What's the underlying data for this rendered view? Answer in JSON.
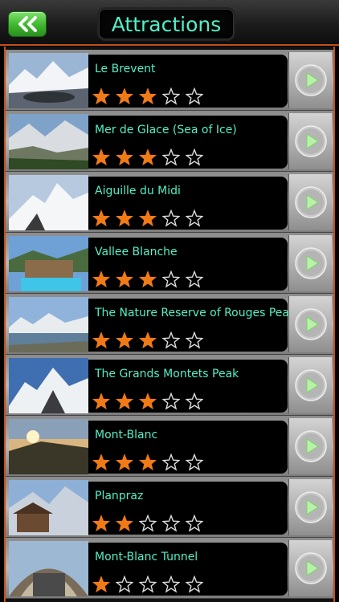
{
  "header": {
    "back_icon": "double-chevron-left-icon",
    "title": "Attractions"
  },
  "colors": {
    "accent_text": "#52f0c8",
    "star_filled": "#f07a16",
    "border": "#c0501c",
    "back_button": "#4ec23c"
  },
  "items": [
    {
      "name": "Le Brevent",
      "rating": 3,
      "max_rating": 5
    },
    {
      "name": "Mer de Glace (Sea of Ice)",
      "rating": 3,
      "max_rating": 5
    },
    {
      "name": "Aiguille du Midi",
      "rating": 3,
      "max_rating": 5
    },
    {
      "name": "Vallee Blanche",
      "rating": 3,
      "max_rating": 5
    },
    {
      "name": "The Nature Reserve of Rouges Peaks",
      "rating": 3,
      "max_rating": 5
    },
    {
      "name": "The Grands Montets Peak",
      "rating": 3,
      "max_rating": 5
    },
    {
      "name": "Mont-Blanc",
      "rating": 3,
      "max_rating": 5
    },
    {
      "name": "Planpraz",
      "rating": 2,
      "max_rating": 5
    },
    {
      "name": "Mont-Blanc Tunnel",
      "rating": 1,
      "max_rating": 5
    }
  ]
}
